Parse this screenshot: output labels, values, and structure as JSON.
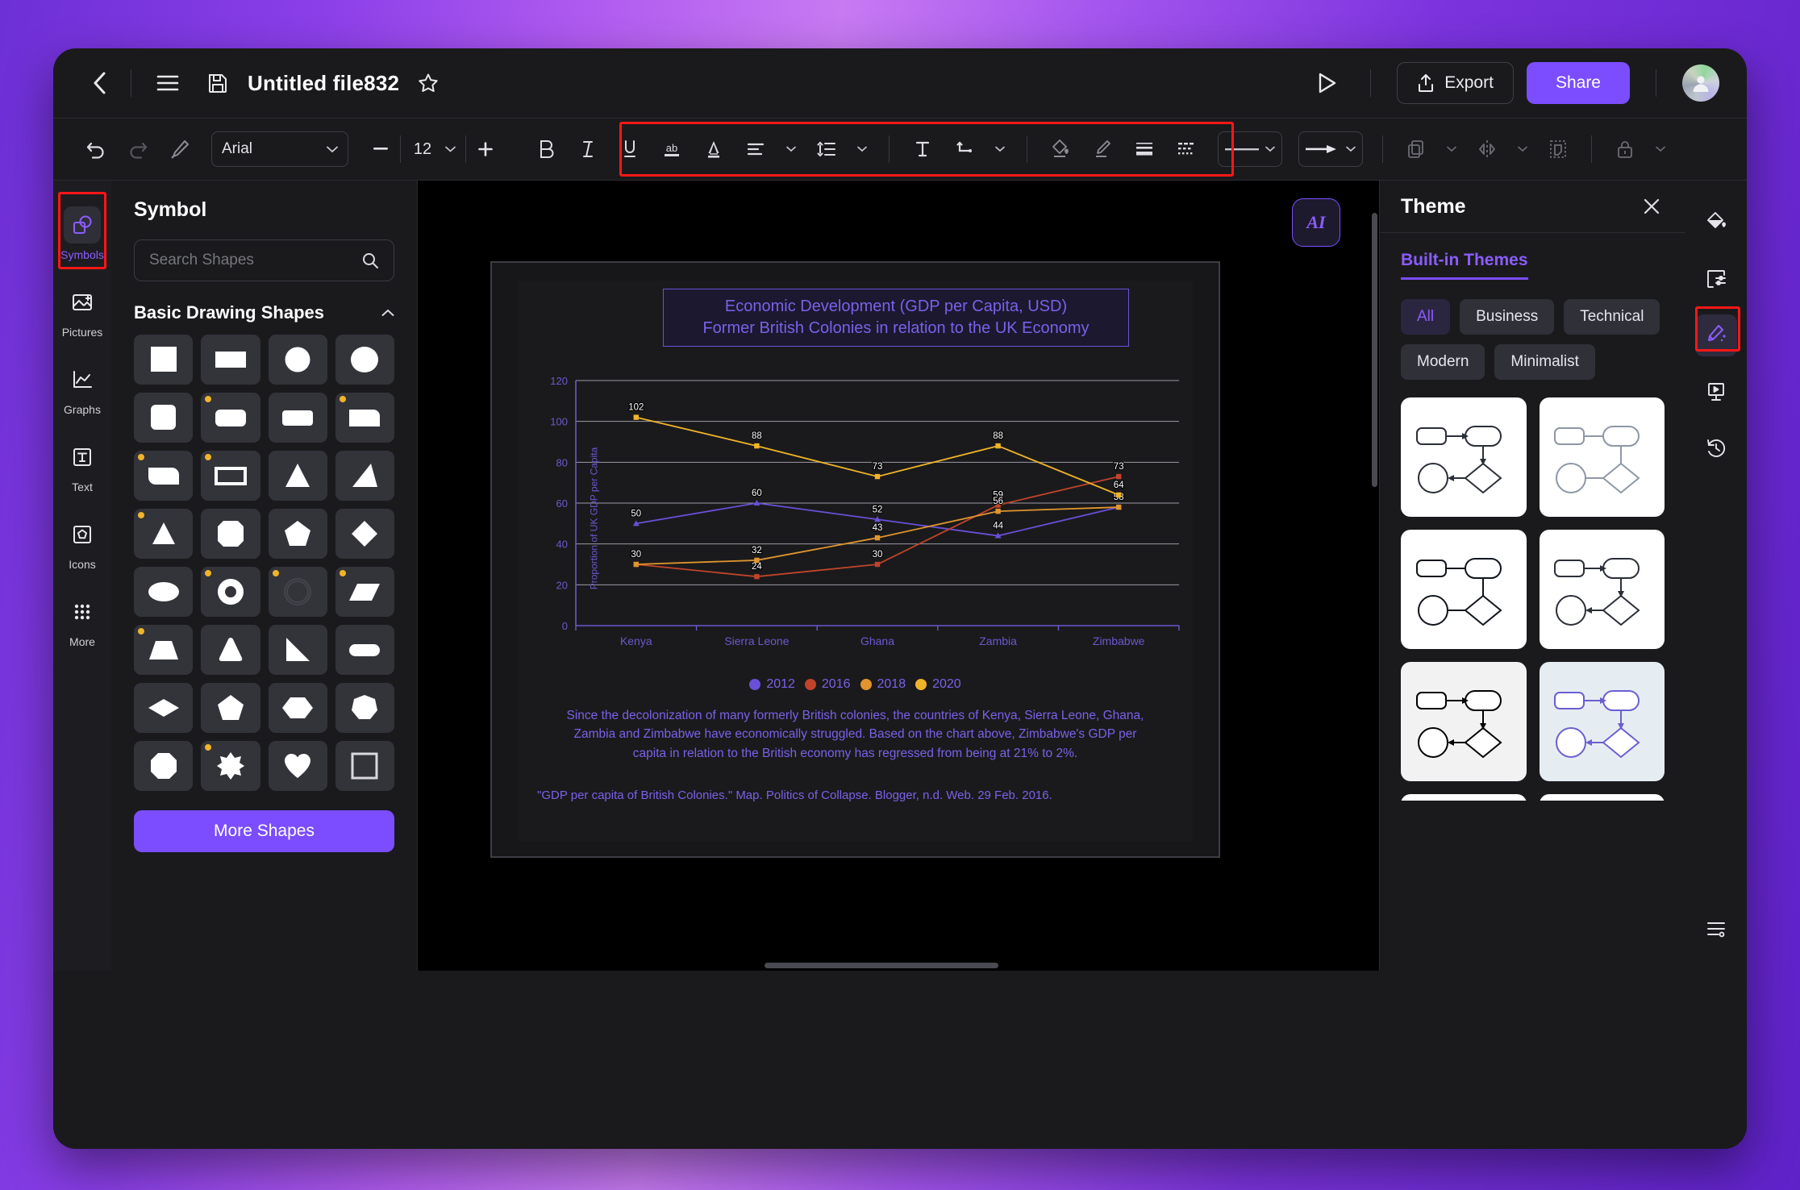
{
  "window": {
    "titlebar": {
      "back_icon": "back-chevron-icon",
      "menu_icon": "hamburger-icon",
      "save_icon": "save-disk-icon",
      "title": "Untitled file832",
      "favorite_icon": "star-icon",
      "play_icon": "play-icon",
      "export_label": "Export",
      "share_label": "Share",
      "avatar_icon": "user-avatar"
    }
  },
  "format_toolbar": {
    "undo": "undo-icon",
    "redo": "redo-icon",
    "format_painter": "format-painter-icon",
    "font_family": "Arial",
    "font_size": "12",
    "minus": "−",
    "plus": "+",
    "bold": "B",
    "italic": "I",
    "underline": "U",
    "strikethrough": "ab",
    "font_color": "A",
    "align": "align-icon",
    "line_spacing": "line-spacing-icon",
    "text_box": "T",
    "connector": "connector-icon",
    "fill": "fill-bucket-icon",
    "brush": "brush-icon",
    "line_weight": "line-weight-icon",
    "line_dash": "line-dash-icon",
    "line_style": "line-style-picker",
    "arrow_style": "arrow-style-picker",
    "layers": "layers-icon",
    "flip": "flip-icon",
    "crop": "crop-icon",
    "lock": "lock-icon"
  },
  "left_rail": {
    "items": [
      {
        "label": "Symbols",
        "icon": "symbols-icon",
        "active": true
      },
      {
        "label": "Pictures",
        "icon": "pictures-icon",
        "active": false
      },
      {
        "label": "Graphs",
        "icon": "graphs-icon",
        "active": false
      },
      {
        "label": "Text",
        "icon": "text-icon",
        "active": false
      },
      {
        "label": "Icons",
        "icon": "icons-icon",
        "active": false
      },
      {
        "label": "More",
        "icon": "more-dots-icon",
        "active": false
      }
    ]
  },
  "symbol_panel": {
    "title": "Symbol",
    "search_placeholder": "Search Shapes",
    "search_value": "",
    "search_icon": "search-icon",
    "section_label": "Basic Drawing Shapes",
    "collapse_icon": "chevron-up-icon",
    "more_shapes_label": "More Shapes",
    "shapes": [
      {
        "name": "square",
        "marker": false
      },
      {
        "name": "rectangle",
        "marker": false
      },
      {
        "name": "circle",
        "marker": false
      },
      {
        "name": "ellipse-circle",
        "marker": false
      },
      {
        "name": "rounded-square",
        "marker": false
      },
      {
        "name": "rounded-rectangle",
        "marker": true
      },
      {
        "name": "rounded-rectangle-2",
        "marker": false
      },
      {
        "name": "single-corner-rounded-rect",
        "marker": true
      },
      {
        "name": "two-corner-rounded-rect",
        "marker": true
      },
      {
        "name": "frame-rectangle",
        "marker": true
      },
      {
        "name": "triangle",
        "marker": false
      },
      {
        "name": "right-triangle",
        "marker": false
      },
      {
        "name": "triangle-2",
        "marker": true
      },
      {
        "name": "octagon-square",
        "marker": false
      },
      {
        "name": "pentagon",
        "marker": false
      },
      {
        "name": "diamond",
        "marker": false
      },
      {
        "name": "oval",
        "marker": false
      },
      {
        "name": "donut",
        "marker": true
      },
      {
        "name": "circle-outline-dashed",
        "marker": true
      },
      {
        "name": "parallelogram",
        "marker": true
      },
      {
        "name": "trapezoid",
        "marker": true
      },
      {
        "name": "rounded-triangle",
        "marker": false
      },
      {
        "name": "right-triangle-2",
        "marker": false
      },
      {
        "name": "stadium",
        "marker": false
      },
      {
        "name": "rhombus-wide",
        "marker": false
      },
      {
        "name": "pentagon-2",
        "marker": false
      },
      {
        "name": "hexagon",
        "marker": false
      },
      {
        "name": "heptagon",
        "marker": false
      },
      {
        "name": "octagon",
        "marker": false
      },
      {
        "name": "star-burst",
        "marker": true
      },
      {
        "name": "heart",
        "marker": false
      },
      {
        "name": "hollow-square",
        "marker": false
      }
    ]
  },
  "canvas": {
    "ai_badge": "ai-assistant-icon"
  },
  "chart_data": {
    "type": "line",
    "title": "Economic Development (GDP per Capita, USD)\nFormer British Colonies in relation to the UK Economy",
    "title_line1": "Economic Development (GDP per Capita, USD)",
    "title_line2": "Former British Colonies in relation to the UK Economy",
    "xlabel": "",
    "ylabel": "Proportion of UK GDP per Capita",
    "categories": [
      "Kenya",
      "Sierra Leone",
      "Ghana",
      "Zambia",
      "Zimbabwe"
    ],
    "ylim": [
      0,
      120
    ],
    "yticks": [
      0,
      20,
      40,
      60,
      80,
      100,
      120
    ],
    "grid": true,
    "legend_position": "bottom",
    "series": [
      {
        "name": "2012",
        "color": "#6a4fd8",
        "values": [
          50,
          60,
          52,
          44,
          58
        ]
      },
      {
        "name": "2016",
        "color": "#c0442a",
        "values": [
          30,
          24,
          30,
          59,
          73
        ]
      },
      {
        "name": "2018",
        "color": "#e0952f",
        "values": [
          30,
          32,
          43,
          56,
          58
        ]
      },
      {
        "name": "2020",
        "color": "#f0b429",
        "values": [
          102,
          88,
          73,
          88,
          64
        ]
      }
    ],
    "caption": "Since the decolonization of many formerly British colonies, the countries of Kenya, Sierra Leone, Ghana, Zambia and Zimbabwe have economically struggled. Based on the chart above, Zimbabwe's GDP per capita in relation to the British economy has regressed from being at 21% to 2%.",
    "source": "\"GDP per capita of British Colonies.\" Map. Politics of Collapse. Blogger, n.d. Web. 29 Feb. 2016."
  },
  "theme_panel": {
    "title": "Theme",
    "close_icon": "close-icon",
    "tab_label": "Built-in Themes",
    "chips": [
      {
        "label": "All",
        "selected": true
      },
      {
        "label": "Business",
        "selected": false
      },
      {
        "label": "Technical",
        "selected": false
      },
      {
        "label": "Modern",
        "selected": false
      },
      {
        "label": "Minimalist",
        "selected": false
      }
    ],
    "cards": [
      {
        "name": "theme-card-1",
        "bg": "#ffffff",
        "stroke": "#2b2f38",
        "fill": "#ffffff",
        "arrow": true
      },
      {
        "name": "theme-card-2",
        "bg": "#ffffff",
        "stroke": "#8d97a6",
        "fill": "#ffffff",
        "arrow": false
      },
      {
        "name": "theme-card-3",
        "bg": "#ffffff",
        "stroke": "#10151c",
        "fill": "#ffffff",
        "arrow": false
      },
      {
        "name": "theme-card-4",
        "bg": "#ffffff",
        "stroke": "#2b2f38",
        "fill": "#ffffff",
        "arrow": true
      },
      {
        "name": "theme-card-5",
        "bg": "#f2f2f2",
        "stroke": "#000000",
        "fill": "#ffffff",
        "arrow": true
      },
      {
        "name": "theme-card-6",
        "bg": "#e6edf2",
        "stroke": "#6b5fd0",
        "fill": "#ffffff",
        "arrow": true
      },
      {
        "name": "theme-card-7",
        "bg": "#ffffff",
        "stroke": "#7fdc92",
        "fill": "#eef3f6",
        "arrow": true
      },
      {
        "name": "theme-card-8",
        "bg": "#ffffff",
        "stroke": "#555a66",
        "fill": "#b278f0",
        "arrow": true
      },
      {
        "name": "theme-card-9",
        "bg": "#2a2a33",
        "stroke": "#ffffff",
        "fill": "#ffffff",
        "arrow": true
      },
      {
        "name": "theme-card-10",
        "bg": "#131b28",
        "stroke": "#cfd6e2",
        "fill": "#131b28",
        "arrow": true
      }
    ]
  },
  "right_rail": {
    "items": [
      {
        "name": "fill-color-icon",
        "active": false
      },
      {
        "name": "page-settings-icon",
        "active": false
      },
      {
        "name": "theme-icon",
        "active": true
      },
      {
        "name": "presentation-icon",
        "active": false
      },
      {
        "name": "history-icon",
        "active": false
      }
    ],
    "bottom_item": {
      "name": "more-options-icon"
    }
  }
}
